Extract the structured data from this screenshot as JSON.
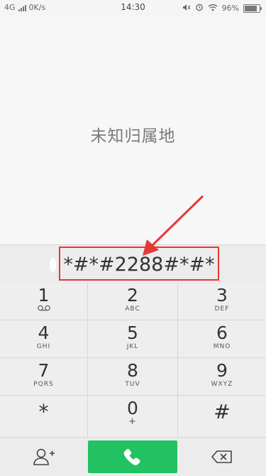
{
  "status_bar": {
    "network": "4G",
    "data_rate": "0K/s",
    "time": "14:30",
    "battery": "96%",
    "battery_level": 0.96,
    "icons": [
      "signal-icon",
      "mute-icon",
      "alarm-icon",
      "wifi-icon",
      "battery-icon"
    ]
  },
  "caller": {
    "location": "未知归属地"
  },
  "dialer": {
    "number": "*#*#2288#*#*",
    "highlight_color": "#e53935"
  },
  "keypad": {
    "keys": [
      {
        "digit": "1",
        "letters": ""
      },
      {
        "digit": "2",
        "letters": "ABC"
      },
      {
        "digit": "3",
        "letters": "DEF"
      },
      {
        "digit": "4",
        "letters": "GHI"
      },
      {
        "digit": "5",
        "letters": "JKL"
      },
      {
        "digit": "6",
        "letters": "MNO"
      },
      {
        "digit": "7",
        "letters": "PQRS"
      },
      {
        "digit": "8",
        "letters": "TUV"
      },
      {
        "digit": "9",
        "letters": "WXYZ"
      },
      {
        "digit": "*",
        "letters": ""
      },
      {
        "digit": "0",
        "letters": "+"
      },
      {
        "digit": "#",
        "letters": ""
      }
    ]
  },
  "actions": {
    "call_color": "#22c262",
    "icons": [
      "add-contact-icon",
      "phone-icon",
      "backspace-icon"
    ]
  }
}
